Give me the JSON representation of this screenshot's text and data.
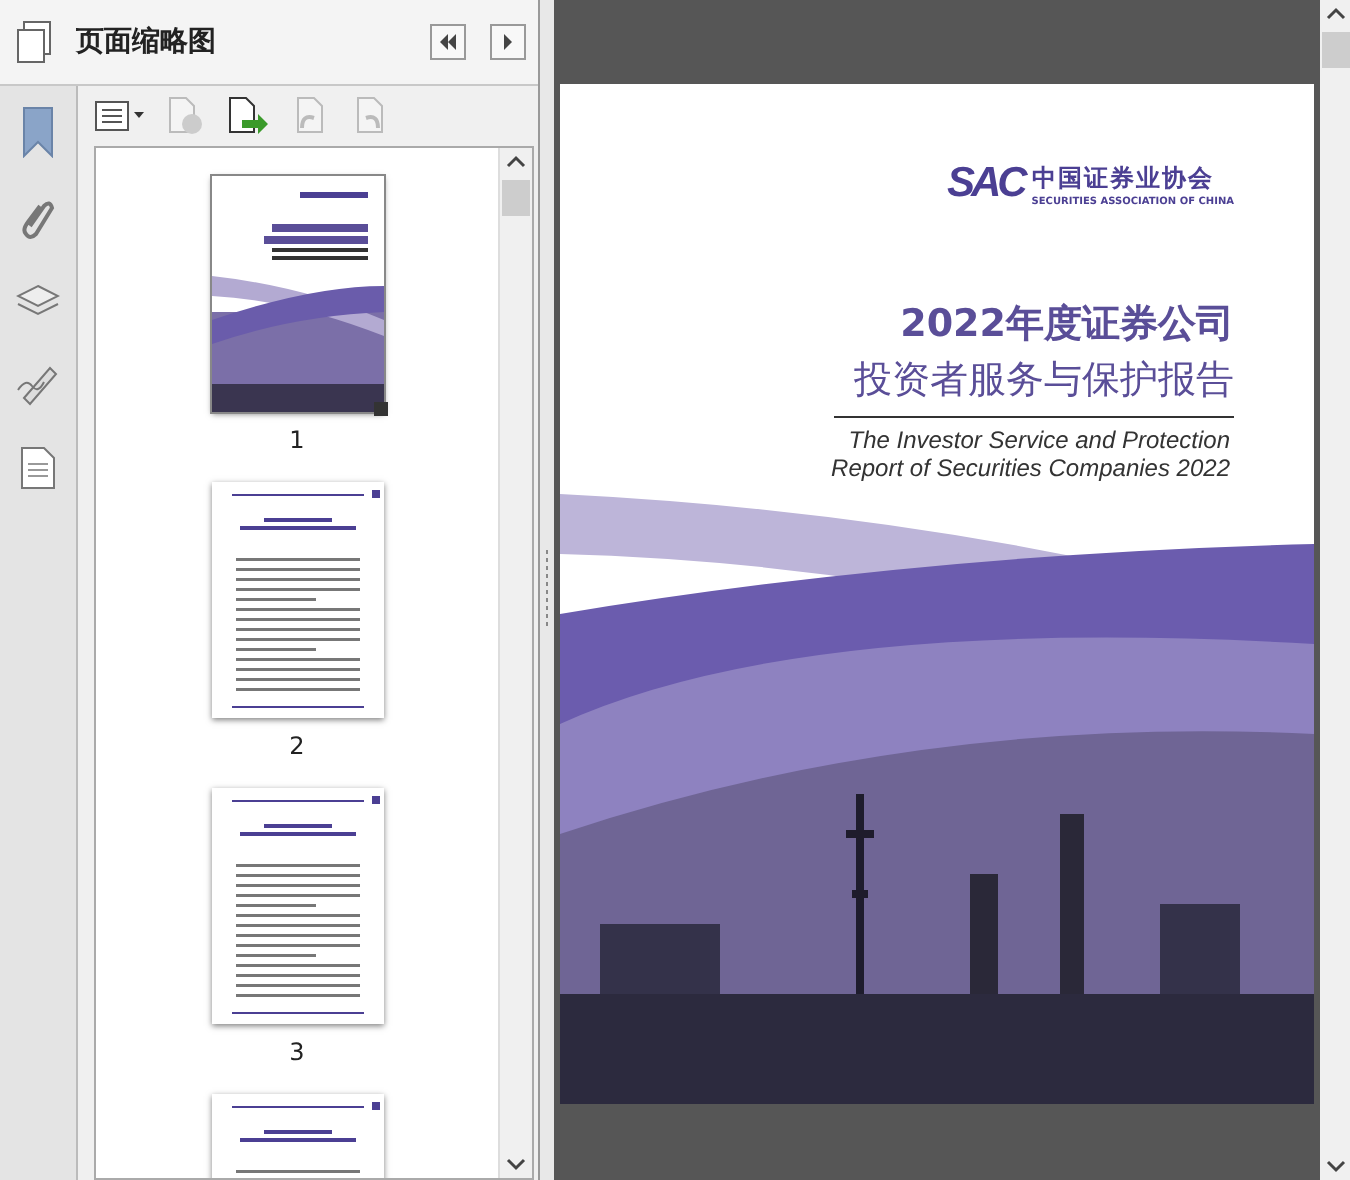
{
  "panel": {
    "title": "页面缩略图"
  },
  "thumbnails": [
    {
      "kind": "cover",
      "page": "1",
      "selected": true
    },
    {
      "kind": "text",
      "page": "2",
      "selected": false
    },
    {
      "kind": "text",
      "page": "3",
      "selected": false
    },
    {
      "kind": "text",
      "selected": false
    }
  ],
  "document": {
    "logo_mark": "SAC",
    "logo_name": "中国证券业协会",
    "logo_subtitle": "SECURITIES ASSOCIATION OF CHINA",
    "title_lines": [
      "2022年度证券公司",
      "投资者服务与保护报告"
    ],
    "subtitle_lines": [
      "The Investor Service and Protection",
      "Report of Securities Companies 2022"
    ]
  }
}
